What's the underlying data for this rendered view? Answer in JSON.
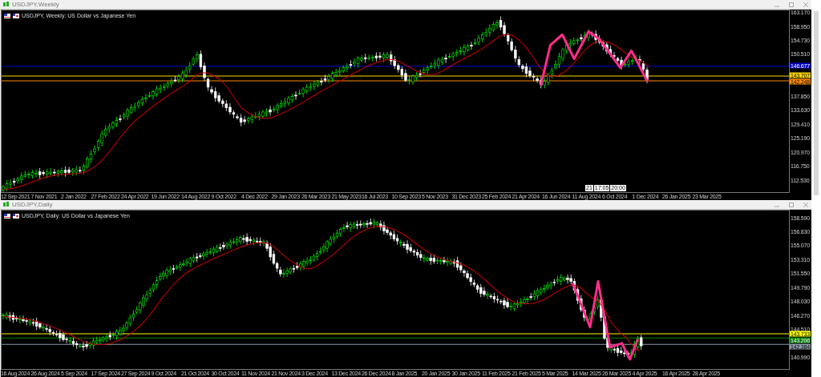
{
  "windows": [
    {
      "title": "USDJPY,Weekly",
      "chart_label": "USDJPY, Weekly:  US Dollar vs Japanese Yen",
      "price_ticks": [
        "163.170",
        "158.950",
        "154.730",
        "150.510",
        "137.850",
        "133.630",
        "129.410",
        "125.190",
        "120.970",
        "116.750",
        "112.530"
      ],
      "price_badges": [
        {
          "text": "146.677",
          "color": "#0000cc"
        },
        {
          "text": "143.707",
          "color": "#ffd700"
        },
        {
          "text": "142.248",
          "color": "#ff8c00"
        }
      ],
      "time_labels": [
        "12 Sep 2021",
        "7 Nov 2021",
        "2 Jan 2022",
        "27 Feb 2022",
        "24 Apr 2022",
        "19 Jun 2022",
        "14 Aug 2022",
        "9 Oct 2022",
        "4 Dec 2022",
        "29 Jan 2023",
        "26 Mar 2023",
        "21 May 2023",
        "16 Jul 2023",
        "10 Sep 2023",
        "5 Nov 2023",
        "31 Dec 2023",
        "25 Feb 2024",
        "21 Apr 2024",
        "16 Jun 2024",
        "11 Aug 2024",
        "6 Oct 2024",
        "1 Dec 2024",
        "26 Jan 2025",
        "23 Mar 2025"
      ],
      "crosshair_labels": [
        "21",
        "17:05",
        "20:00"
      ]
    },
    {
      "title": "USDJPY,Daily",
      "chart_label": "USDJPY, Daily:  US Dollar vs Japanese Yen",
      "price_ticks": [
        "158.590",
        "156.830",
        "155.070",
        "153.310",
        "151.550",
        "149.790",
        "148.030",
        "146.270",
        "144.510",
        "140.990"
      ],
      "price_badges": [
        {
          "text": "143.733",
          "color": "#ffff00"
        },
        {
          "text": "143.206",
          "color": "#008000"
        },
        {
          "text": "142.384",
          "color": "#8c9aa8"
        }
      ],
      "time_labels": [
        "16 Aug 2024",
        "26 Aug 2024",
        "5 Sep 2024",
        "17 Sep 2024",
        "27 Sep 2024",
        "9 Oct 2024",
        "21 Oct 2024",
        "30 Oct 2024",
        "11 Nov 2024",
        "21 Nov 2024",
        "3 Dec 2024",
        "13 Dec 2024",
        "26 Dec 2024",
        "8 Jan 2025",
        "20 Jan 2025",
        "30 Jan 2025",
        "11 Feb 2025",
        "21 Feb 2025",
        "5 Mar 2025",
        "14 Mar 2025",
        "26 Mar 2025",
        "4 Apr 2025",
        "16 Apr 2025",
        "28 Apr 2025"
      ]
    }
  ]
}
